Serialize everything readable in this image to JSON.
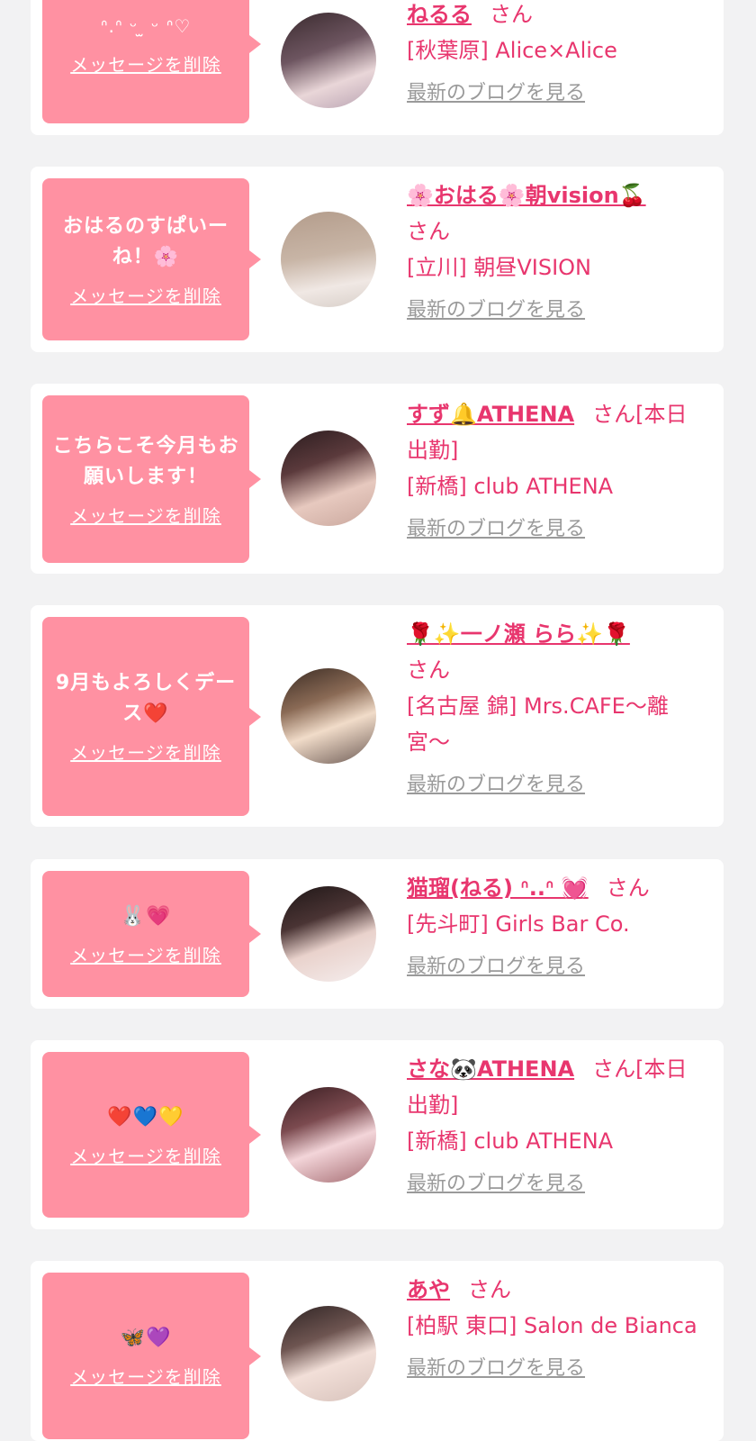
{
  "common": {
    "delete_label": "メッセージを削除",
    "blog_label": "最新のブログを見る",
    "honorific": "さん"
  },
  "entries": [
    {
      "message": "ᐢ.ᐢ ᵕ ̫ ᵕ ᐢ♡",
      "name": "ねるる",
      "suffix": "",
      "shop": "[秋葉原] Alice×Alice"
    },
    {
      "message": "おはるのすぱいーね！🌸",
      "name": "🌸おはる🌸朝vision🍒",
      "suffix": "",
      "shop": "[立川] 朝昼VISION"
    },
    {
      "message": "こちらこそ今月もお願いします！",
      "name": "すず🔔ATHENA",
      "suffix": "[本日出勤]",
      "shop": "[新橋] club ATHENA"
    },
    {
      "message": "9月もよろしくデース❤️",
      "name": "🌹✨一ノ瀬 らら✨🌹",
      "suffix": "",
      "shop": "[名古屋 錦] Mrs.CAFE〜離宮〜"
    },
    {
      "message": "🐰💗",
      "name": "猫瑠(ねる) ᐢ..ᐢ 💓",
      "suffix": "",
      "shop": "[先斗町] Girls Bar Co."
    },
    {
      "message": "❤️💙💛",
      "name": "さな🐼ATHENA",
      "suffix": "[本日出勤]",
      "shop": "[新橋] club ATHENA"
    },
    {
      "message": "🦋💜",
      "name": "あや",
      "suffix": "",
      "shop": "[柏駅 東口] Salon de Bianca"
    }
  ],
  "colors": {
    "bubble": "#ff91a2",
    "accent": "#e8366e",
    "muted": "#9a9a9a",
    "background": "#f2f2f3"
  }
}
